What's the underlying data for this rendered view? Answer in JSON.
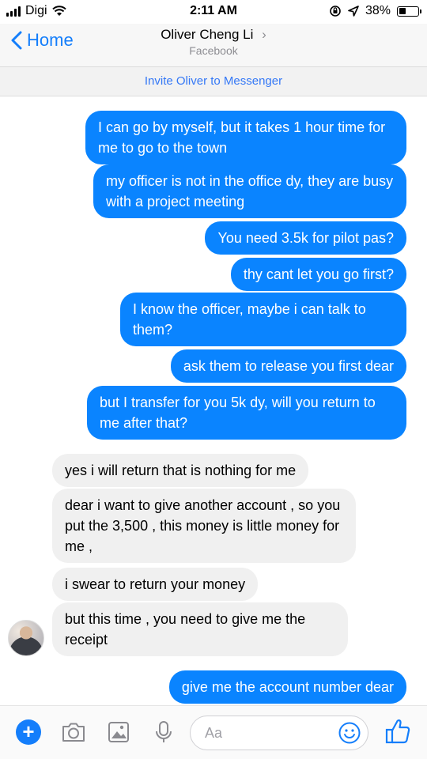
{
  "status_bar": {
    "carrier": "Digi",
    "time": "2:11 AM",
    "battery": "38%",
    "battery_level": 0.38
  },
  "nav": {
    "back_label": "Home",
    "contact_name": "Oliver Cheng Li",
    "contact_source": "Facebook"
  },
  "invite_label": "Invite Oliver to Messenger",
  "messages": [
    {
      "from": "me",
      "text": "I can go by myself, but it takes 1 hour time for me to go to the town"
    },
    {
      "from": "me",
      "text": "my officer is not in the office dy, they are busy with a project meeting"
    },
    {
      "from": "me",
      "text": "You need 3.5k for pilot pas?"
    },
    {
      "from": "me",
      "text": "thy cant let you go first?"
    },
    {
      "from": "me",
      "text": "I know the officer, maybe i can talk to them?"
    },
    {
      "from": "me",
      "text": "ask them to release you first dear"
    },
    {
      "from": "me",
      "text": "but I transfer for you 5k dy, will you return to me after that?"
    },
    {
      "from": "them",
      "text": "yes i will return that is nothing for me"
    },
    {
      "from": "them",
      "text": "dear i want to give another account , so you put the 3,500 , this money is little money for me ,"
    },
    {
      "from": "them",
      "text": "i swear to return your money"
    },
    {
      "from": "them",
      "text": "but this time , you need to give me the receipt"
    },
    {
      "from": "me",
      "text": "give me the account number dear"
    }
  ],
  "composer": {
    "placeholder": "Aa",
    "icons": [
      "plus-icon",
      "camera-icon",
      "photo-icon",
      "microphone-icon",
      "emoji-icon",
      "thumbs-up-icon"
    ]
  },
  "colors": {
    "outgoing_bubble": "#0a84ff",
    "incoming_bubble": "#f0f0f0",
    "accent": "#147efb"
  }
}
